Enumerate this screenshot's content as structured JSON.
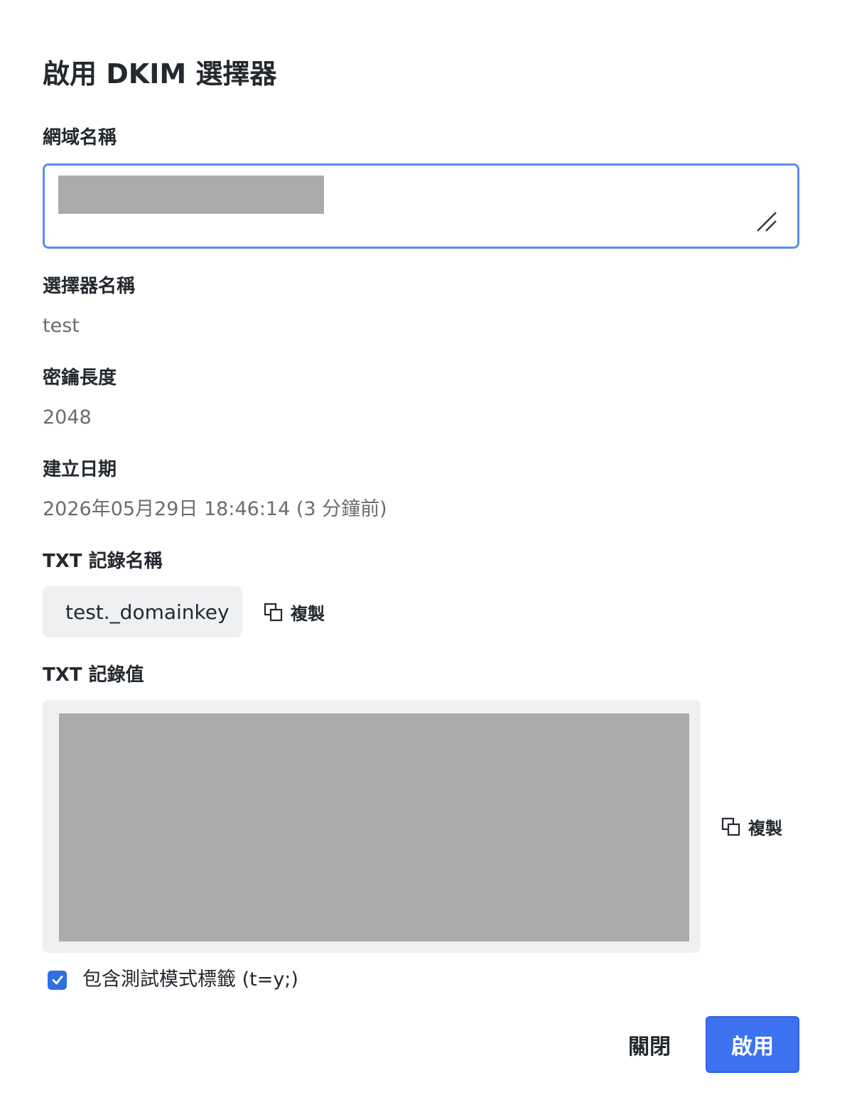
{
  "dialog": {
    "title": "啟用 DKIM 選擇器"
  },
  "fields": {
    "domain": {
      "label": "網域名稱",
      "value": ""
    },
    "selector": {
      "label": "選擇器名稱",
      "value": "test"
    },
    "key_length": {
      "label": "密鑰長度",
      "value": "2048"
    },
    "created": {
      "label": "建立日期",
      "value": "2026年05月29日 18:46:14 (3 分鐘前)"
    },
    "txt_name": {
      "label": "TXT 記錄名稱",
      "value": "test._domainkey",
      "copy_label": "複製"
    },
    "txt_value": {
      "label": "TXT 記錄值",
      "value": "",
      "copy_label": "複製"
    }
  },
  "test_mode": {
    "label": "包含測試模式標籤 (t=y;)",
    "checked": true
  },
  "footer": {
    "close_label": "關閉",
    "enable_label": "啟用"
  },
  "colors": {
    "accent": "#3d72f0",
    "focus_border": "#5b8def",
    "muted_text": "#6c6c6c",
    "box_bg": "#eff0f2"
  }
}
